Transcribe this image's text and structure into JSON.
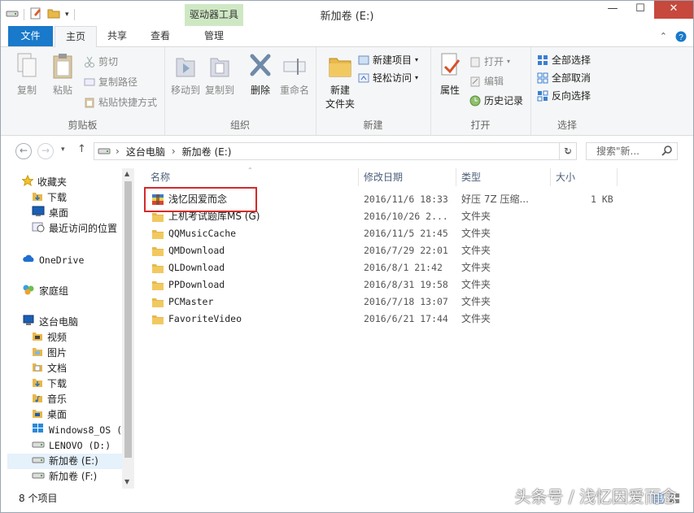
{
  "window": {
    "title": "新加卷 (E:)",
    "context_tab_title": "驱动器工具",
    "minimize": "—",
    "maximize": "☐",
    "close": "✕"
  },
  "tabs": {
    "file": "文件",
    "home": "主页",
    "share": "共享",
    "view": "查看",
    "manage": "管理"
  },
  "ribbon": {
    "clipboard": {
      "label": "剪贴板",
      "copy": "复制",
      "paste": "粘贴",
      "cut": "剪切",
      "copy_path": "复制路径",
      "paste_shortcut": "粘贴快捷方式"
    },
    "organize": {
      "label": "组织",
      "move_to": "移动到",
      "copy_to": "复制到",
      "delete": "删除",
      "rename": "重命名"
    },
    "new": {
      "label": "新建",
      "new_folder": "新建\n文件夹",
      "new_folder_l1": "新建",
      "new_folder_l2": "文件夹",
      "new_item": "新建项目",
      "easy_access": "轻松访问"
    },
    "open": {
      "label": "打开",
      "properties": "属性",
      "open": "打开",
      "edit": "编辑",
      "history": "历史记录"
    },
    "select": {
      "label": "选择",
      "select_all": "全部选择",
      "select_none": "全部取消",
      "invert": "反向选择"
    }
  },
  "address": {
    "path": [
      "这台电脑",
      "新加卷 (E:)"
    ],
    "search_placeholder": "搜索\"新...",
    "path_sep": "›"
  },
  "nav_pane": {
    "favorites": "收藏夹",
    "downloads": "下载",
    "desktop": "桌面",
    "recent": "最近访问的位置",
    "onedrive": "OneDrive",
    "homegroup": "家庭组",
    "this_pc": "这台电脑",
    "videos": "视频",
    "pictures": "图片",
    "documents": "文档",
    "downloads2": "下载",
    "music": "音乐",
    "desktop2": "桌面",
    "win_os": "Windows8_OS (",
    "lenovo": "LENOVO (D:)",
    "new_e": "新加卷 (E:)",
    "new_f": "新加卷 (F:)"
  },
  "columns": {
    "name": "名称",
    "date": "修改日期",
    "type": "类型",
    "size": "大小"
  },
  "files": [
    {
      "name": "浅忆因爱而念",
      "date": "2016/11/6 18:33",
      "type": "好压 7Z 压缩...",
      "size": "1 KB",
      "kind": "archive"
    },
    {
      "name": "上机考试题库MS (G)",
      "date": "2016/10/26 2...",
      "type": "文件夹",
      "size": "",
      "kind": "folder"
    },
    {
      "name": "QQMusicCache",
      "date": "2016/11/5 21:45",
      "type": "文件夹",
      "size": "",
      "kind": "folder"
    },
    {
      "name": "QMDownload",
      "date": "2016/7/29 22:01",
      "type": "文件夹",
      "size": "",
      "kind": "folder"
    },
    {
      "name": "QLDownload",
      "date": "2016/8/1 21:42",
      "type": "文件夹",
      "size": "",
      "kind": "folder"
    },
    {
      "name": "PPDownload",
      "date": "2016/8/31 19:58",
      "type": "文件夹",
      "size": "",
      "kind": "folder"
    },
    {
      "name": "PCMaster",
      "date": "2016/7/18 13:07",
      "type": "文件夹",
      "size": "",
      "kind": "folder"
    },
    {
      "name": "FavoriteVideo",
      "date": "2016/6/21 17:44",
      "type": "文件夹",
      "size": "",
      "kind": "folder"
    }
  ],
  "status": {
    "count": "8 个项目"
  },
  "watermark": "头条号 / 浅忆因爱而念",
  "colors": {
    "file_tab": "#1979ca",
    "context_tab": "#cfe8c4",
    "close_btn": "#c7483c",
    "highlight": "#d42a2a",
    "folder": "#e8b84a"
  }
}
